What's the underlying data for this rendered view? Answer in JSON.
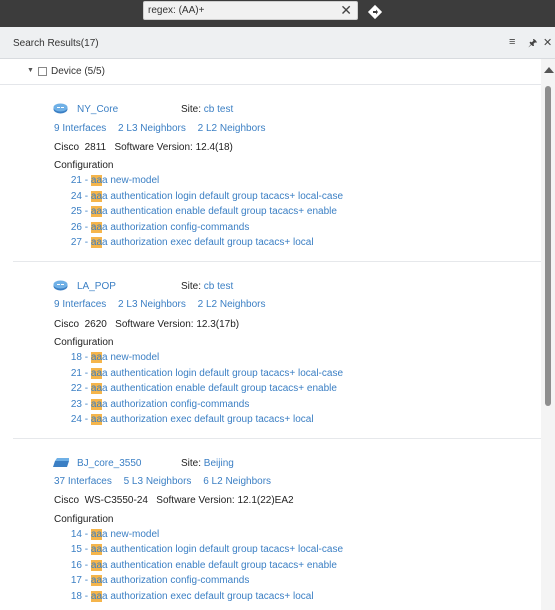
{
  "search": {
    "value": "regex: (AA)+"
  },
  "panel": {
    "title": "Search Results(17)"
  },
  "group": {
    "label": "Device (5/5)"
  },
  "devices": [
    {
      "name": "NY_Core",
      "site_label": "Site:",
      "site": "cb test",
      "interfaces": "9 Interfaces",
      "l3": "2 L3 Neighbors",
      "l2": "2 L2 Neighbors",
      "vendor": "Cisco",
      "model": "2811",
      "sw_label": "Software Version:",
      "sw": "12.4(18)",
      "config_title": "Configuration",
      "config": [
        {
          "num": "21",
          "pre": "aa",
          "rest": "a new-model"
        },
        {
          "num": "24",
          "pre": "aa",
          "rest": "a authentication login default group tacacs+ local-case"
        },
        {
          "num": "25",
          "pre": "aa",
          "rest": "a authentication enable default group tacacs+ enable"
        },
        {
          "num": "26",
          "pre": "aa",
          "rest": "a authorization config-commands"
        },
        {
          "num": "27",
          "pre": "aa",
          "rest": "a authorization exec default group tacacs+ local"
        }
      ]
    },
    {
      "name": "LA_POP",
      "site_label": "Site:",
      "site": "cb test",
      "interfaces": "9 Interfaces",
      "l3": "2 L3 Neighbors",
      "l2": "2 L2 Neighbors",
      "vendor": "Cisco",
      "model": "2620",
      "sw_label": "Software Version:",
      "sw": "12.3(17b)",
      "config_title": "Configuration",
      "config": [
        {
          "num": "18",
          "pre": "aa",
          "rest": "a new-model"
        },
        {
          "num": "21",
          "pre": "aa",
          "rest": "a authentication login default group tacacs+ local-case"
        },
        {
          "num": "22",
          "pre": "aa",
          "rest": "a authentication enable default group tacacs+ enable"
        },
        {
          "num": "23",
          "pre": "aa",
          "rest": "a authorization config-commands"
        },
        {
          "num": "24",
          "pre": "aa",
          "rest": "a authorization exec default group tacacs+ local"
        }
      ]
    },
    {
      "name": "BJ_core_3550",
      "site_label": "Site:",
      "site": "Beijing",
      "interfaces": "37 Interfaces",
      "l3": "5 L3 Neighbors",
      "l2": "6 L2 Neighbors",
      "vendor": "Cisco",
      "model": "WS-C3550-24",
      "sw_label": "Software Version:",
      "sw": "12.1(22)EA2",
      "config_title": "Configuration",
      "config": [
        {
          "num": "14",
          "pre": "aa",
          "rest": "a new-model"
        },
        {
          "num": "15",
          "pre": "aa",
          "rest": "a authentication login default group tacacs+ local-case"
        },
        {
          "num": "16",
          "pre": "aa",
          "rest": "a authentication enable default group tacacs+ enable"
        },
        {
          "num": "17",
          "pre": "aa",
          "rest": "a authorization config-commands"
        },
        {
          "num": "18",
          "pre": "aa",
          "rest": "a authorization exec default group tacacs+ local"
        }
      ]
    }
  ],
  "icons": {
    "clear": "close-icon",
    "navigate": "navigate-icon",
    "menu": "menu-icon",
    "pin": "pin-icon",
    "close": "close-icon",
    "router": "router-icon",
    "switch": "switch-icon"
  },
  "colors": {
    "link": "#3b7fc4",
    "highlight": "#f5b54b",
    "topbar": "#3c3c3c"
  }
}
